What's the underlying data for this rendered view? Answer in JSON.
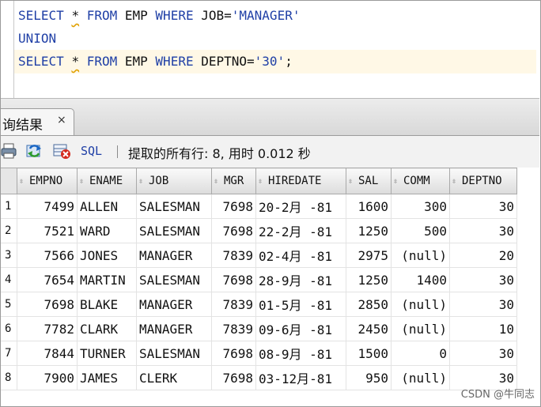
{
  "editor": {
    "lines": [
      [
        {
          "t": "SELECT",
          "c": "kw"
        },
        {
          "t": " ",
          "c": "id"
        },
        {
          "t": "*",
          "c": "sq"
        },
        {
          "t": " ",
          "c": "id"
        },
        {
          "t": "FROM",
          "c": "kw"
        },
        {
          "t": " EMP ",
          "c": "id"
        },
        {
          "t": "WHERE",
          "c": "kw"
        },
        {
          "t": " JOB=",
          "c": "id"
        },
        {
          "t": "'MANAGER'",
          "c": "str"
        }
      ],
      [
        {
          "t": "UNION",
          "c": "kw"
        }
      ],
      [
        {
          "t": "SELECT",
          "c": "kw"
        },
        {
          "t": " ",
          "c": "id"
        },
        {
          "t": "*",
          "c": "sq"
        },
        {
          "t": " ",
          "c": "id"
        },
        {
          "t": "FROM",
          "c": "kw"
        },
        {
          "t": " EMP ",
          "c": "id"
        },
        {
          "t": "WHERE",
          "c": "kw"
        },
        {
          "t": " DEPTNO=",
          "c": "id"
        },
        {
          "t": "'30'",
          "c": "str"
        },
        {
          "t": ";",
          "c": "id"
        }
      ]
    ]
  },
  "result_tab": {
    "label": "询结果",
    "close": "×"
  },
  "toolbar": {
    "sql_label": "SQL",
    "status": "提取的所有行: 8, 用时 0.012 秒",
    "icons": [
      "print-icon",
      "refresh-icon",
      "delete-icon"
    ]
  },
  "grid": {
    "columns": [
      "EMPNO",
      "ENAME",
      "JOB",
      "MGR",
      "HIREDATE",
      "SAL",
      "COMM",
      "DEPTNO"
    ],
    "rows": [
      [
        "1",
        "7499",
        "ALLEN",
        "SALESMAN",
        "7698",
        "20-2月 -81",
        "1600",
        "300",
        "30"
      ],
      [
        "2",
        "7521",
        "WARD",
        "SALESMAN",
        "7698",
        "22-2月 -81",
        "1250",
        "500",
        "30"
      ],
      [
        "3",
        "7566",
        "JONES",
        "MANAGER",
        "7839",
        "02-4月 -81",
        "2975",
        "(null)",
        "20"
      ],
      [
        "4",
        "7654",
        "MARTIN",
        "SALESMAN",
        "7698",
        "28-9月 -81",
        "1250",
        "1400",
        "30"
      ],
      [
        "5",
        "7698",
        "BLAKE",
        "MANAGER",
        "7839",
        "01-5月 -81",
        "2850",
        "(null)",
        "30"
      ],
      [
        "6",
        "7782",
        "CLARK",
        "MANAGER",
        "7839",
        "09-6月 -81",
        "2450",
        "(null)",
        "10"
      ],
      [
        "7",
        "7844",
        "TURNER",
        "SALESMAN",
        "7698",
        "08-9月 -81",
        "1500",
        "0",
        "30"
      ],
      [
        "8",
        "7900",
        "JAMES",
        "CLERK",
        "7698",
        "03-12月-81",
        "950",
        "(null)",
        "30"
      ]
    ]
  },
  "watermark": "CSDN @牛同志"
}
